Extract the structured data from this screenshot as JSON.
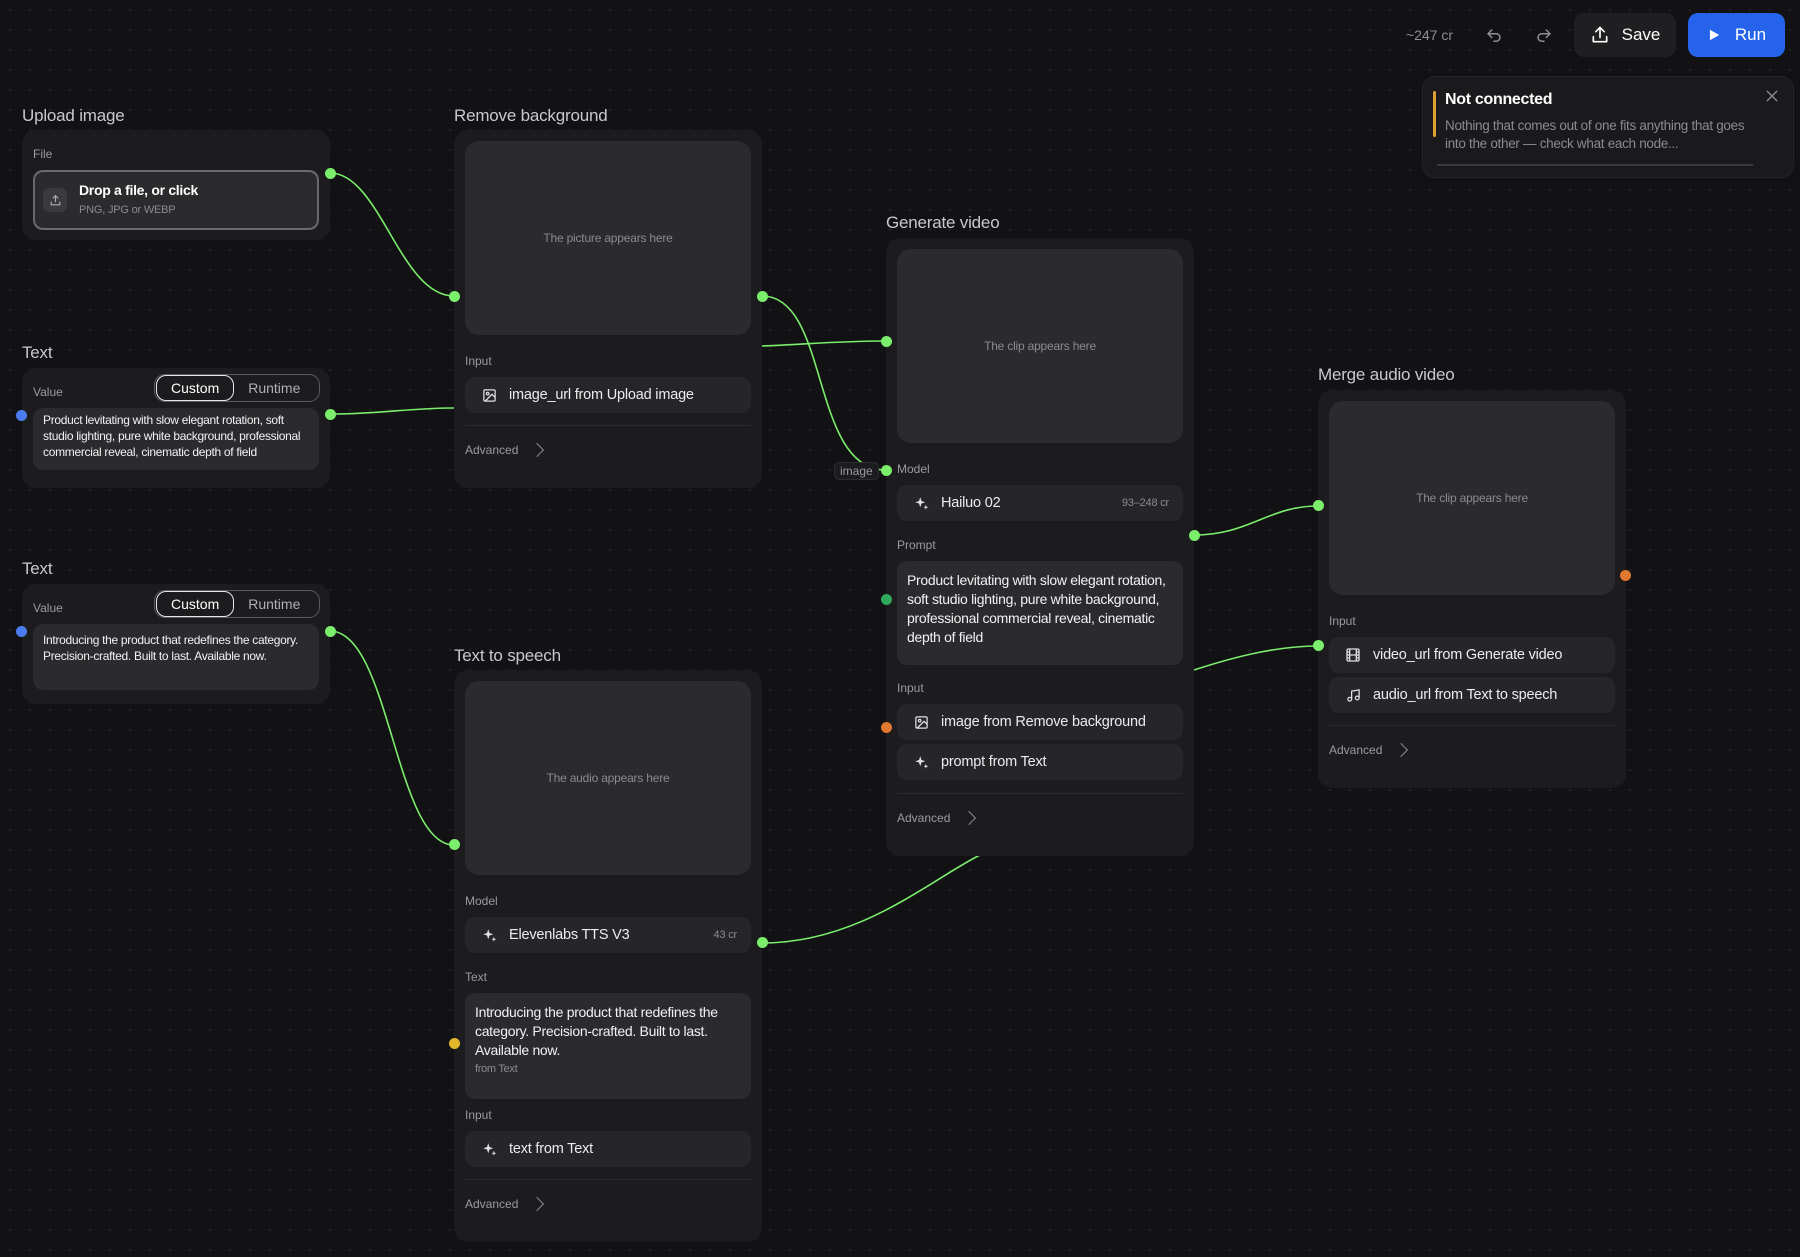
{
  "toolbar": {
    "credits": "~247 cr",
    "save_label": "Save",
    "run_label": "Run",
    "accent": "#2563eb"
  },
  "toast": {
    "title": "Not connected",
    "message": "Nothing that comes out of one fits anything that goes into the other — check what each node...",
    "accent": "#e0a030"
  },
  "upload": {
    "title": "Upload image",
    "file_label": "File",
    "drop_text": "Drop a file, or click",
    "formats": "PNG, JPG or WEBP"
  },
  "text1": {
    "title": "Text",
    "value_label": "Value",
    "mode_custom": "Custom",
    "mode_runtime": "Runtime",
    "value": "Product levitating with slow elegant rotation, soft studio lighting, pure white background, professional commercial reveal, cinematic depth of field"
  },
  "text2": {
    "title": "Text",
    "value_label": "Value",
    "mode_custom": "Custom",
    "mode_runtime": "Runtime",
    "value": "Introducing the product that redefines the category. Precision-crafted. Built to last. Available now."
  },
  "remove_bg": {
    "title": "Remove background",
    "preview": "The picture appears here",
    "input_label": "Input",
    "input_item": "image_url from Upload image",
    "advanced": "Advanced"
  },
  "tts": {
    "title": "Text to speech",
    "preview": "The audio appears here",
    "model_label": "Model",
    "model": "Elevenlabs TTS V3",
    "model_cost": "43 cr",
    "text_label": "Text",
    "text": "Introducing the product that redefines the category. Precision-crafted. Built to last. Available now.",
    "text_source": "from Text",
    "input_label": "Input",
    "input_item": "text from Text",
    "advanced": "Advanced"
  },
  "gen_video": {
    "title": "Generate video",
    "preview": "The clip appears here",
    "model_label": "Model",
    "model": "Hailuo 02",
    "model_cost": "93–248 cr",
    "prompt_label": "Prompt",
    "prompt": "Product levitating with slow elegant rotation, soft studio lighting, pure white background, professional commercial reveal, cinematic depth of field",
    "input_label": "Input",
    "input_items": [
      "image from Remove background",
      "prompt from Text"
    ],
    "advanced": "Advanced",
    "edge_label": "image"
  },
  "merge": {
    "title": "Merge audio video",
    "preview": "The clip appears here",
    "input_label": "Input",
    "input_items": [
      "video_url from Generate video",
      "audio_url from Text to speech"
    ],
    "advanced": "Advanced"
  },
  "colors": {
    "wire": "#7bee6c",
    "port_text": "#4a7cf0",
    "port_media": "#e0782f"
  }
}
